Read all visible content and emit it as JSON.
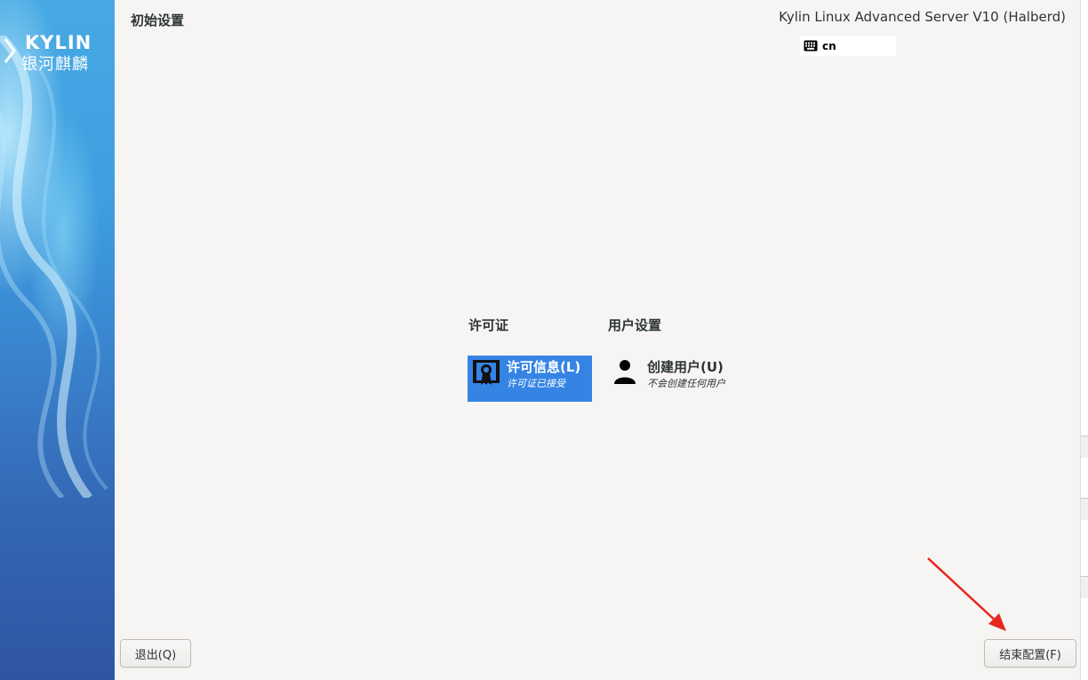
{
  "header": {
    "title": "初始设置",
    "product": "Kylin Linux Advanced Server V10 (Halberd)",
    "keyboard_layout": "cn"
  },
  "logo": {
    "english": "KYLIN",
    "chinese": "银河麒麟"
  },
  "hub": {
    "categories": [
      {
        "title": "许可证",
        "spokes": [
          {
            "title": "许可信息(L)",
            "status": "许可证已接受",
            "icon": "license-icon",
            "selected": true
          }
        ]
      },
      {
        "title": "用户设置",
        "spokes": [
          {
            "title": "创建用户(U)",
            "status": "不会创建任何用户",
            "icon": "user-icon",
            "selected": false
          }
        ]
      }
    ]
  },
  "footer": {
    "quit_label": "退出(Q)",
    "finish_label": "结束配置(F)"
  },
  "colors": {
    "selection": "#3584e4",
    "background": "#f6f5f4",
    "annotation_arrow": "#e8261c",
    "sidebar_top": "#46a9e3",
    "sidebar_bottom": "#2f55a2"
  }
}
